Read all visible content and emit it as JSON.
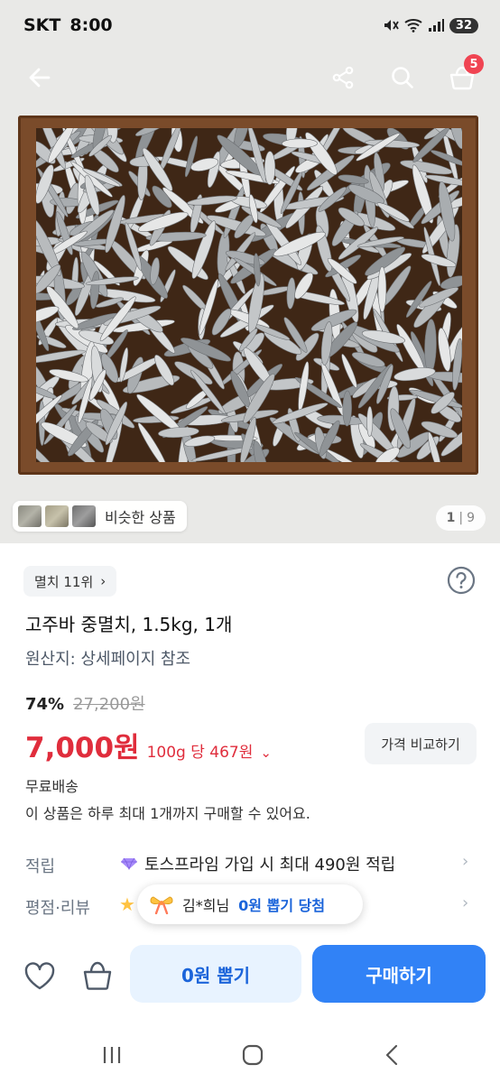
{
  "status_bar": {
    "carrier": "SKT",
    "time": "8:00",
    "battery": "32"
  },
  "header": {
    "cart_count": "5"
  },
  "gallery": {
    "similar_label": "비슷한 상품",
    "page_current": "1",
    "page_sep": "|",
    "page_total": "9"
  },
  "product": {
    "rank": "멸치 11위",
    "rank_chevron": "›",
    "title": "고주바 중멸치, 1.5kg, 1개",
    "origin": "원산지: 상세페이지 참조",
    "discount": "74%",
    "original_price": "27,200원",
    "price": "7,000원",
    "unit_price": "100g 당 467원",
    "unit_price_chevron": "⌄",
    "compare_label": "가격 비교하기",
    "shipping": "무료배송",
    "limit_note": "이 상품은 하루 최대 1개까지 구매할 수 있어요."
  },
  "info_rows": {
    "reward_label": "적립",
    "reward_value": "토스프라임 가입 시 최대 490원 적립",
    "review_label": "평점·리뷰",
    "chevron": "›",
    "star": "★"
  },
  "toast": {
    "name": "김*희님",
    "desc": "0원 뽑기 당첨"
  },
  "bottom": {
    "draw_label": "0원 뽑기",
    "buy_label": "구매하기"
  },
  "colors": {
    "accent": "#3182f6",
    "price_red": "#e02d3c",
    "badge_red": "#f04452",
    "draw_bg": "#e8f3ff"
  }
}
